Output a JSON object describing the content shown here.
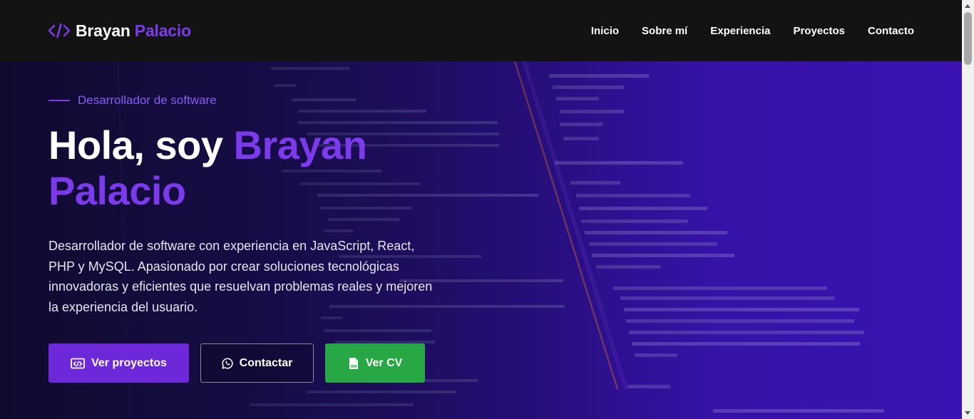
{
  "brand": {
    "first_name": "Brayan",
    "last_name": "Palacio",
    "icon": "code-icon"
  },
  "nav": {
    "items": [
      {
        "label": "Inicio"
      },
      {
        "label": "Sobre mí"
      },
      {
        "label": "Experiencia"
      },
      {
        "label": "Proyectos"
      },
      {
        "label": "Contacto"
      }
    ]
  },
  "hero": {
    "eyebrow": "Desarrollador de software",
    "title_prefix": "Hola, soy ",
    "title_accent": "Brayan Palacio",
    "description": "Desarrollador de software con experiencia en JavaScript, React, PHP y MySQL. Apasionado por crear soluciones tecnológicas innovadoras y eficientes que resuelvan problemas reales y mejoren la experiencia del usuario.",
    "buttons": [
      {
        "label": "Ver proyectos",
        "icon": "code-window-icon"
      },
      {
        "label": "Contactar",
        "icon": "whatsapp-icon"
      },
      {
        "label": "Ver CV",
        "icon": "pdf-file-icon"
      }
    ]
  },
  "colors": {
    "accent": "#7c3aed",
    "primary_button": "#6d28d9",
    "success_button": "#28a745",
    "navbar": "#131313"
  }
}
